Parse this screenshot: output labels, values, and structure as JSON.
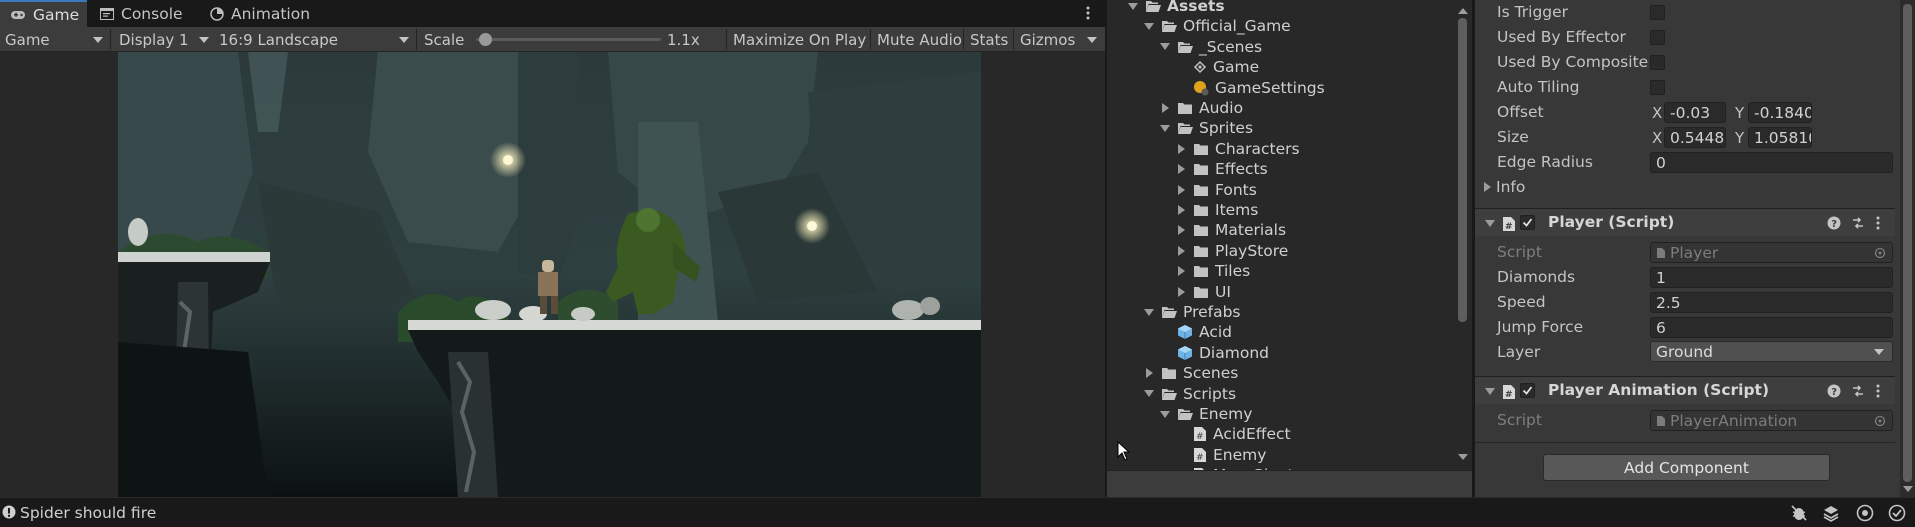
{
  "tabs": {
    "game": "Game",
    "console": "Console",
    "animation": "Animation"
  },
  "toolbar": {
    "view_mode": "Game",
    "display": "Display 1",
    "aspect": "16:9 Landscape",
    "scale_label": "Scale",
    "scale_value": "1.1x",
    "scale_fraction": 0.05,
    "maximize": "Maximize On Play",
    "mute": "Mute Audio",
    "stats": "Stats",
    "gizmos": "Gizmos"
  },
  "project": {
    "rows": [
      {
        "label": "Assets",
        "icon": "folder-open-icon",
        "expand": "down",
        "bold": true
      },
      {
        "label": "Official_Game",
        "icon": "folder-open-icon",
        "expand": "down"
      },
      {
        "label": "_Scenes",
        "icon": "folder-open-icon",
        "expand": "down"
      },
      {
        "label": "Game",
        "icon": "scene-icon",
        "expand": "none"
      },
      {
        "label": "GameSettings",
        "icon": "settings-asset-icon",
        "expand": "none"
      },
      {
        "label": "Audio",
        "icon": "folder-icon",
        "expand": "right"
      },
      {
        "label": "Sprites",
        "icon": "folder-open-icon",
        "expand": "down"
      },
      {
        "label": "Characters",
        "icon": "folder-icon",
        "expand": "right"
      },
      {
        "label": "Effects",
        "icon": "folder-icon",
        "expand": "right"
      },
      {
        "label": "Fonts",
        "icon": "folder-icon",
        "expand": "right"
      },
      {
        "label": "Items",
        "icon": "folder-icon",
        "expand": "right"
      },
      {
        "label": "Materials",
        "icon": "folder-icon",
        "expand": "right"
      },
      {
        "label": "PlayStore",
        "icon": "folder-icon",
        "expand": "right"
      },
      {
        "label": "Tiles",
        "icon": "folder-icon",
        "expand": "right"
      },
      {
        "label": "UI",
        "icon": "folder-icon",
        "expand": "right"
      },
      {
        "label": "Prefabs",
        "icon": "folder-open-icon",
        "expand": "down"
      },
      {
        "label": "Acid",
        "icon": "prefab-icon",
        "expand": "none"
      },
      {
        "label": "Diamond",
        "icon": "prefab-icon",
        "expand": "none"
      },
      {
        "label": "Scenes",
        "icon": "folder-icon",
        "expand": "right"
      },
      {
        "label": "Scripts",
        "icon": "folder-open-icon",
        "expand": "down"
      },
      {
        "label": "Enemy",
        "icon": "folder-open-icon",
        "expand": "down"
      },
      {
        "label": "AcidEffect",
        "icon": "script-icon",
        "expand": "none"
      },
      {
        "label": "Enemy",
        "icon": "script-icon",
        "expand": "none"
      },
      {
        "label": "MossGiant",
        "icon": "script-icon",
        "expand": "none"
      }
    ]
  },
  "inspector": {
    "collider": {
      "is_trigger": "Is Trigger",
      "used_by_effector": "Used By Effector",
      "used_by_composite": "Used By Composite",
      "auto_tiling": "Auto Tiling",
      "offset_label": "Offset",
      "offset_x": "-0.03",
      "offset_y": "-0.1840",
      "size_label": "Size",
      "size_x": "0.5448",
      "size_y": "1.05810",
      "edge_radius_label": "Edge Radius",
      "edge_radius": "0",
      "info": "Info",
      "x_label": "X",
      "y_label": "Y"
    },
    "player": {
      "title": "Player (Script)",
      "script_label": "Script",
      "script_value": "Player",
      "diamonds_label": "Diamonds",
      "diamonds": "1",
      "speed_label": "Speed",
      "speed": "2.5",
      "jump_label": "Jump Force",
      "jump": "6",
      "layer_label": "Layer",
      "layer": "Ground"
    },
    "player_animation": {
      "title": "Player Animation (Script)",
      "script_label": "Script",
      "script_value": "PlayerAnimation"
    },
    "add_component": "Add Component"
  },
  "status": {
    "message": "Spider should fire"
  },
  "colors": {
    "accent": "#3a79bb",
    "panel": "#383838",
    "dark": "#191919"
  }
}
